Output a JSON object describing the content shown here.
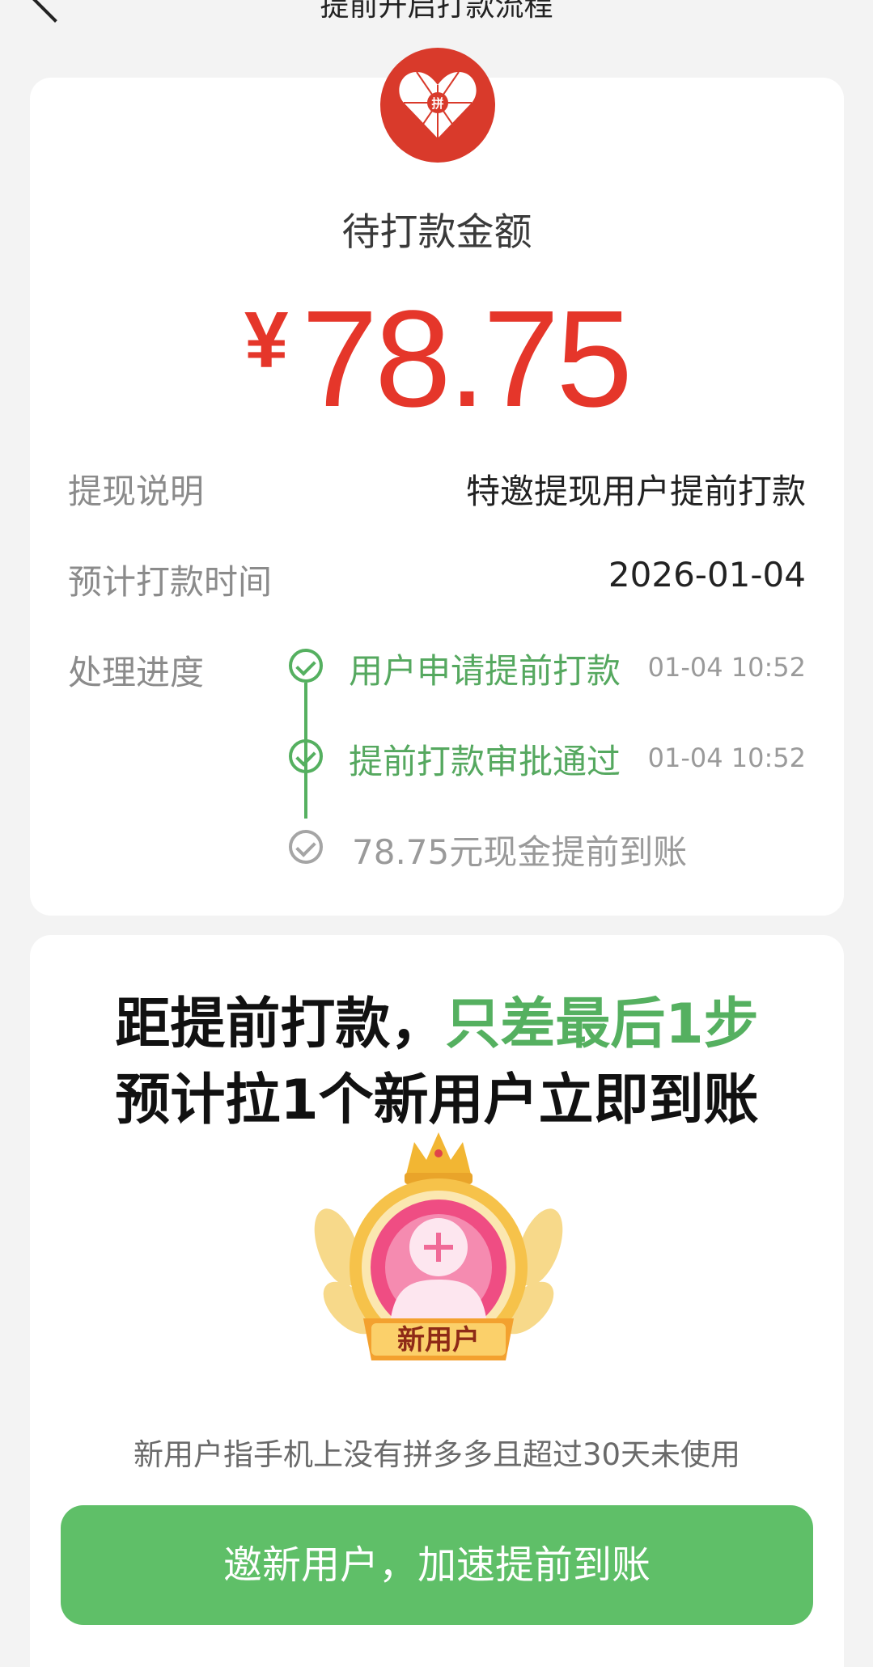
{
  "header": {
    "title": "提前开启打款流程"
  },
  "amount_card": {
    "label": "待打款金额",
    "currency": "¥",
    "amount": "78.75",
    "rows": [
      {
        "label": "提现说明",
        "value": "特邀提现用户提前打款"
      },
      {
        "label": "预计打款时间",
        "value": "2026-01-04"
      }
    ],
    "progress_label": "处理进度",
    "steps": [
      {
        "text": "用户申请提前打款",
        "time": "01-04 10:52",
        "status": "done"
      },
      {
        "text": "提前打款审批通过",
        "time": "01-04 10:52",
        "status": "done"
      },
      {
        "text": "78.75元现金提前到账",
        "time": "",
        "status": "pending"
      }
    ]
  },
  "invite_card": {
    "headline_prefix": "距提前打款，",
    "headline_highlight": "只差最后1步",
    "headline_line2": "预计拉1个新用户立即到账",
    "badge_label": "新用户",
    "note": "新用户指手机上没有拼多多且超过30天未使用",
    "cta_label": "邀新用户，加速提前到账"
  },
  "colors": {
    "accent_red": "#e5362a",
    "accent_green": "#5fbf68",
    "background": "#f3f3f3"
  },
  "icons": [
    "back-icon",
    "pinduoduo-logo-icon",
    "check-circle-icon",
    "new-user-badge-icon"
  ]
}
